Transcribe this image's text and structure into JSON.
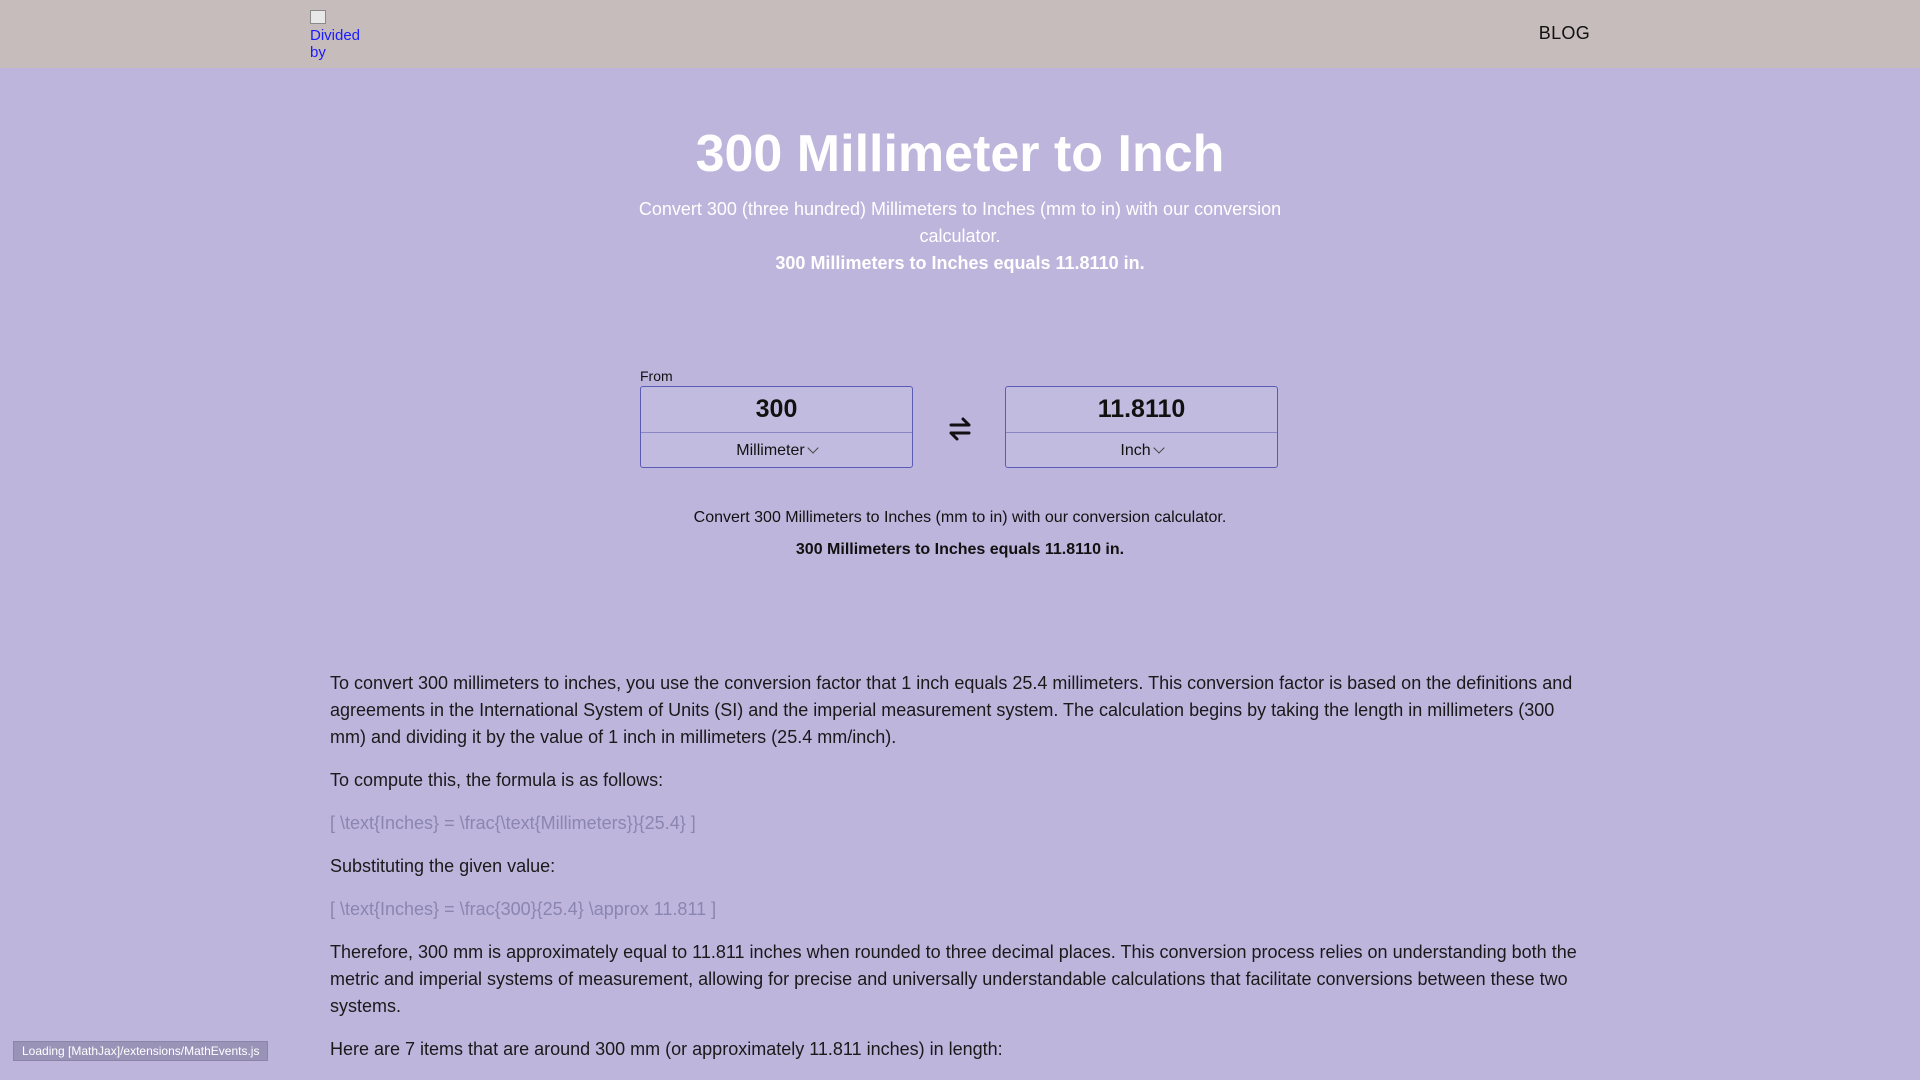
{
  "header": {
    "logo_alt_line1": "Divided",
    "logo_alt_line2": "by",
    "blog_label": "BLOG"
  },
  "hero": {
    "title": "300 Millimeter to Inch",
    "subtitle": "Convert 300 (three hundred) Millimeters to Inches (mm to in) with our conversion calculator.",
    "result": "300 Millimeters to Inches equals 11.8110 in."
  },
  "converter": {
    "from_label": "From",
    "from_value": "300",
    "from_unit": "Millimeter",
    "to_value": "11.8110",
    "to_unit": "Inch",
    "swap_icon": "swap-arrows-icon"
  },
  "summary": {
    "line1": "Convert 300 Millimeters to Inches (mm to in) with our conversion calculator.",
    "line2": "300 Millimeters to Inches equals 11.8110 in."
  },
  "article": {
    "p1": "To convert 300 millimeters to inches, you use the conversion factor that 1 inch equals 25.4 millimeters. This conversion factor is based on the definitions and agreements in the International System of Units (SI) and the imperial measurement system. The calculation begins by taking the length in millimeters (300 mm) and dividing it by the value of 1 inch in millimeters (25.4 mm/inch).",
    "p2": "To compute this, the formula is as follows:",
    "math1": "[ \\text{Inches} = \\frac{\\text{Millimeters}}{25.4} ]",
    "p3": "Substituting the given value:",
    "math2": "[ \\text{Inches} = \\frac{300}{25.4} \\approx 11.811 ]",
    "p4": "Therefore, 300 mm is approximately equal to 11.811 inches when rounded to three decimal places. This conversion process relies on understanding both the metric and imperial systems of measurement, allowing for precise and universally understandable calculations that facilitate conversions between these two systems.",
    "p5": "Here are 7 items that are around 300 mm (or approximately 11.811 inches) in length:"
  },
  "status": {
    "mathjax_loading": "Loading [MathJax]/extensions/MathEvents.js"
  },
  "colors": {
    "background": "#bdb5dc",
    "topbar": "#c6bcbc",
    "accent_border": "#5b5ab5"
  }
}
